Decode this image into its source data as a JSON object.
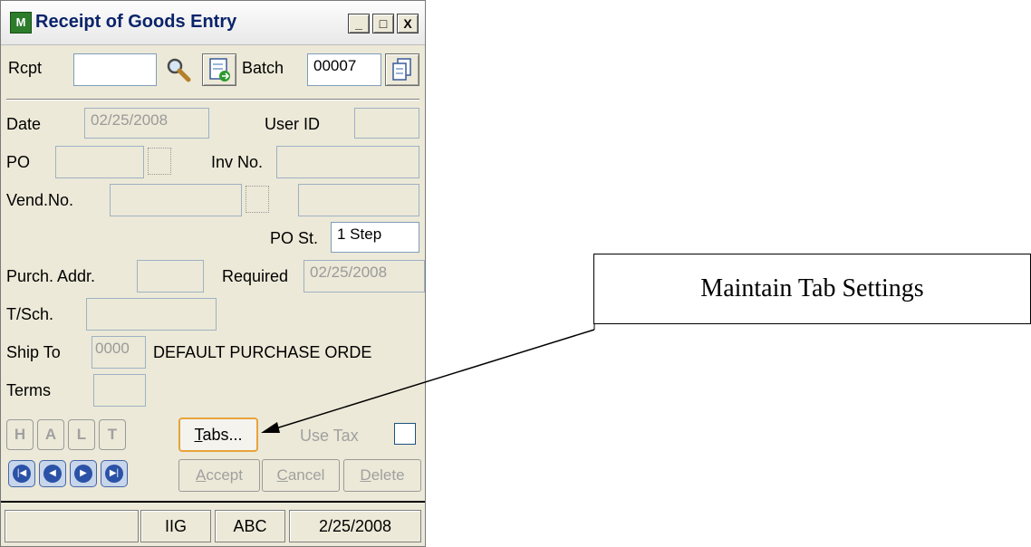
{
  "window": {
    "title": "Receipt of Goods Entry",
    "buttons": [
      "_",
      "□",
      "X"
    ]
  },
  "header": {
    "rcpt_label": "Rcpt",
    "rcpt_value": "",
    "batch_label": "Batch",
    "batch_value": "00007"
  },
  "form": {
    "date_label": "Date",
    "date_value": "02/25/2008",
    "userid_label": "User ID",
    "userid_value": "",
    "po_label": "PO",
    "po_value": "",
    "invno_label": "Inv No.",
    "invno_value": "",
    "vendno_label": "Vend.No.",
    "vendno_value": "",
    "vendname_value": "",
    "post_label": "PO St.",
    "post_value": "1 Step",
    "purchaddr_label": "Purch. Addr.",
    "purchaddr_value": "",
    "required_label": "Required",
    "required_value": "02/25/2008",
    "tsch_label": "T/Sch.",
    "tsch_value": "",
    "shipto_label": "Ship To",
    "shipto_code": "0000",
    "shipto_name": "DEFAULT PURCHASE ORDE",
    "terms_label": "Terms",
    "terms_value": ""
  },
  "buttons": {
    "header_tabs": [
      "H",
      "A",
      "L",
      "T"
    ],
    "tabs_label_prefix": "T",
    "tabs_label_rest": "abs...",
    "usetax_label": "Use Tax",
    "accept_u": "A",
    "accept_rest": "ccept",
    "cancel_u": "C",
    "cancel_rest": "ancel",
    "delete_u": "D",
    "delete_rest": "elete"
  },
  "statusbar": [
    "",
    "IIG",
    "ABC",
    "2/25/2008"
  ],
  "callout": {
    "text": "Maintain Tab Settings"
  }
}
